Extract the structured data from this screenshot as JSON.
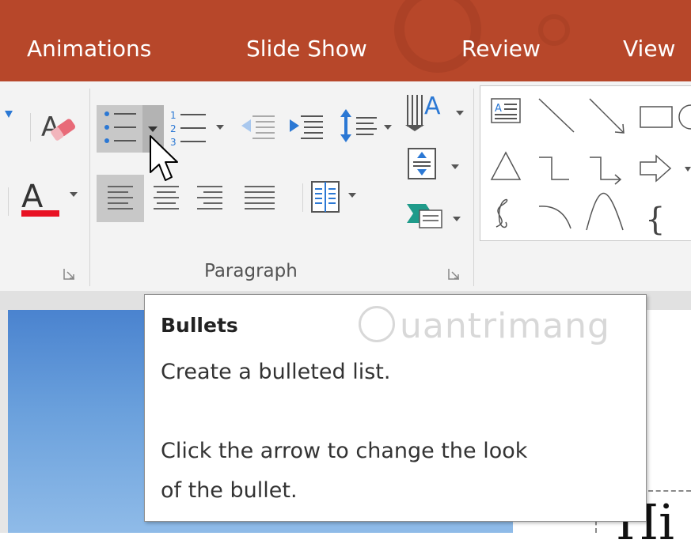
{
  "tabs": {
    "animations": "Animations",
    "slide_show": "Slide Show",
    "review": "Review",
    "view": "View"
  },
  "ribbon": {
    "paragraph_group_label": "Paragraph",
    "bullets_highlighted": true,
    "align_left_highlighted": true,
    "icons": [
      "font-color-icon",
      "clear-formatting-icon",
      "bullets-icon",
      "numbering-icon",
      "decrease-indent-icon",
      "increase-indent-icon",
      "line-spacing-icon",
      "text-direction-icon",
      "align-text-icon",
      "convert-to-smartart-icon",
      "align-left-icon",
      "center-icon",
      "align-right-icon",
      "justify-icon",
      "columns-icon"
    ]
  },
  "tooltip": {
    "title": "Bullets",
    "description": "Create a bulleted list.",
    "hint_line1": "Click the arrow to change the look",
    "hint_line2": "of the bullet."
  },
  "watermark": {
    "text": "uantrimang"
  },
  "slide": {
    "title_fragment": "Hi"
  },
  "colors": {
    "tab_bar": "#b7472a",
    "ribbon": "#f3f3f3",
    "font_color_bar": "#e81123",
    "icon_blue": "#2b78d4",
    "highlight": "#c8c8c8"
  }
}
